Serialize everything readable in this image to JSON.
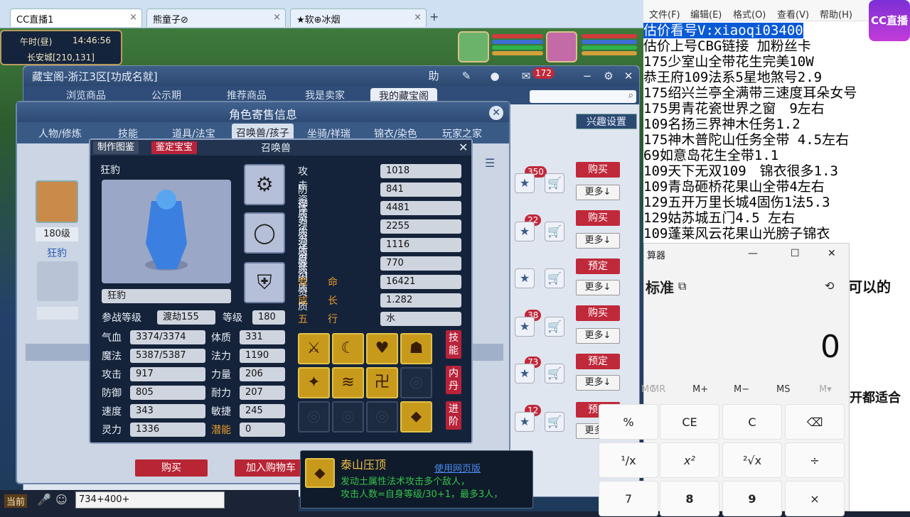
{
  "browser_tabs": [
    {
      "label": "CC直播1",
      "active": true
    },
    {
      "label": "熊童子⊘",
      "active": false
    },
    {
      "label": "★软⊕冰烟",
      "active": false
    }
  ],
  "hud": {
    "time": "午时(昼)",
    "clock": "14:46:56",
    "location": "长安城[210,131]"
  },
  "cbg": {
    "title": "藏宝阁-浙江3区[功成名就]",
    "help": "助",
    "mail_count": "172",
    "nav": [
      "浏览商品",
      "公示期",
      "推荐商品",
      "我是卖家",
      "我的藏宝阁"
    ],
    "interest_btn": "兴趣设置",
    "left_level": "180级",
    "left_name": "狂豹",
    "listings": [
      {
        "count": "350",
        "action": "购买",
        "more": "更多↓"
      },
      {
        "count": "22",
        "action": "购买",
        "more": "更多↓"
      },
      {
        "count": "",
        "action": "预定",
        "more": "更多↓"
      },
      {
        "count": "38",
        "action": "购买",
        "more": "更多↓"
      },
      {
        "count": "73",
        "action": "预定",
        "more": "更多↓"
      },
      {
        "count": "12",
        "action": "预定",
        "more": "更多↓"
      }
    ]
  },
  "sale": {
    "title": "角色寄售信息",
    "tabs": [
      "人物/修炼",
      "技能",
      "道具/法宝",
      "召唤兽/孩子",
      "坐骑/祥瑞",
      "锦衣/染色",
      "玩家之家"
    ],
    "buy": "购买",
    "add_cart": "加入购物车"
  },
  "summon": {
    "tab1": "制作图鉴",
    "tab2": "鉴定宝宝",
    "title": "召唤兽",
    "name": "狂豹",
    "name_field": "狂豹",
    "battle_level_label": "参战等级",
    "battle_level": "渡劫155",
    "level_label": "等级",
    "level": "180",
    "qualities": [
      {
        "label": "攻击资质",
        "value": "1018"
      },
      {
        "label": "防御资质",
        "value": "841"
      },
      {
        "label": "体力资质",
        "value": "4481"
      },
      {
        "label": "法力资质",
        "value": "2255"
      },
      {
        "label": "速度资质",
        "value": "1116"
      },
      {
        "label": "躲闪资质",
        "value": "770"
      }
    ],
    "life_label": "寿　　命",
    "life": "16421",
    "growth_label": "成　　长",
    "growth": "1.282",
    "element_label": "五　　行",
    "element": "水",
    "stats_left": [
      {
        "label": "气血",
        "value": "3374/3374"
      },
      {
        "label": "魔法",
        "value": "5387/5387"
      },
      {
        "label": "攻击",
        "value": "917"
      },
      {
        "label": "防御",
        "value": "805"
      },
      {
        "label": "速度",
        "value": "343"
      },
      {
        "label": "灵力",
        "value": "1336"
      }
    ],
    "stats_right": [
      {
        "label": "体质",
        "value": "331"
      },
      {
        "label": "法力",
        "value": "1190"
      },
      {
        "label": "力量",
        "value": "206"
      },
      {
        "label": "耐力",
        "value": "207"
      },
      {
        "label": "敏捷",
        "value": "245"
      },
      {
        "label": "潜能",
        "value": "0"
      }
    ],
    "side_buttons": [
      "技能",
      "内丹",
      "进阶"
    ]
  },
  "tooltip": {
    "name": "泰山压顶",
    "link": "使用网页版",
    "line1": "发动土属性法术攻击多个敌人，",
    "line2": "攻击人数=自身等级/30+1，最多3人，"
  },
  "chat": {
    "channel": "当前",
    "input": "734+400+"
  },
  "notepad": {
    "menu": [
      "文件(F)",
      "编辑(E)",
      "格式(O)",
      "查看(V)",
      "帮助(H)"
    ],
    "lines": [
      "估价看号V:xiaoqi03400",
      "估价上号CBG链接  加粉丝卡",
      "175少室山全带花生完美10W",
      "恭王府109法系5星地煞号2.9",
      "175绍兴兰亭全满带三速度耳朵女号",
      "175男青花瓷世界之窗　9左右",
      "109名扬三界神木任务1.2",
      "175神木普陀山任务全带 4.5左右",
      "69如意岛花生全带1.1",
      "109天下无双109　锦衣很多1.3",
      "109青岛砸桥花果山全带4左右",
      "129五开万里长城4固伤1法5.3",
      "129姑苏城五门4.5 左右",
      "109蓬莱风云花果山光膀子锦衣"
    ]
  },
  "calculator": {
    "title": "算器",
    "mode": "标准",
    "display": "0",
    "memory": [
      "MC",
      "MR",
      "M+",
      "M−",
      "MS",
      "M▾"
    ],
    "row1": [
      "%",
      "CE",
      "C",
      "⌫"
    ],
    "row2": [
      "¹/x",
      "x²",
      "²√x",
      "÷"
    ],
    "row3": [
      "7",
      "8",
      "9",
      "×"
    ]
  },
  "behind_text": {
    "t1": "可以的",
    "t2": "开都适合"
  },
  "logo": {
    "text": "CC直播"
  }
}
